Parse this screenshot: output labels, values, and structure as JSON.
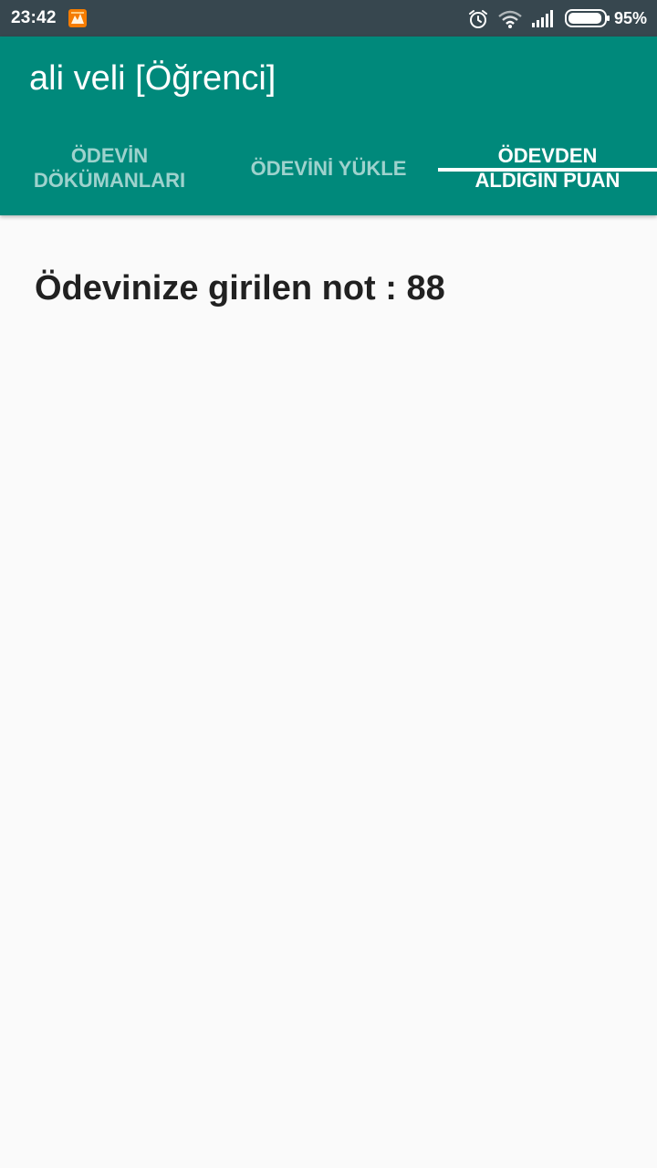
{
  "status_bar": {
    "time": "23:42",
    "battery_percent_label": "95%",
    "battery_level": 0.95,
    "icons": [
      "notification-app-icon",
      "alarm-icon",
      "wifi-icon",
      "signal-icon",
      "battery-icon"
    ]
  },
  "app_bar": {
    "title": "ali veli [Öğrenci]",
    "color": "#00897b"
  },
  "tabs": [
    {
      "label": "ÖDEVİN DÖKÜMANLARI",
      "active": false
    },
    {
      "label": "ÖDEVİNİ YÜKLE",
      "active": false
    },
    {
      "label": "ÖDEVDEN ALDIĞIN PUAN",
      "active": true
    }
  ],
  "content": {
    "grade_text": "Ödevinize girilen not : 88"
  }
}
